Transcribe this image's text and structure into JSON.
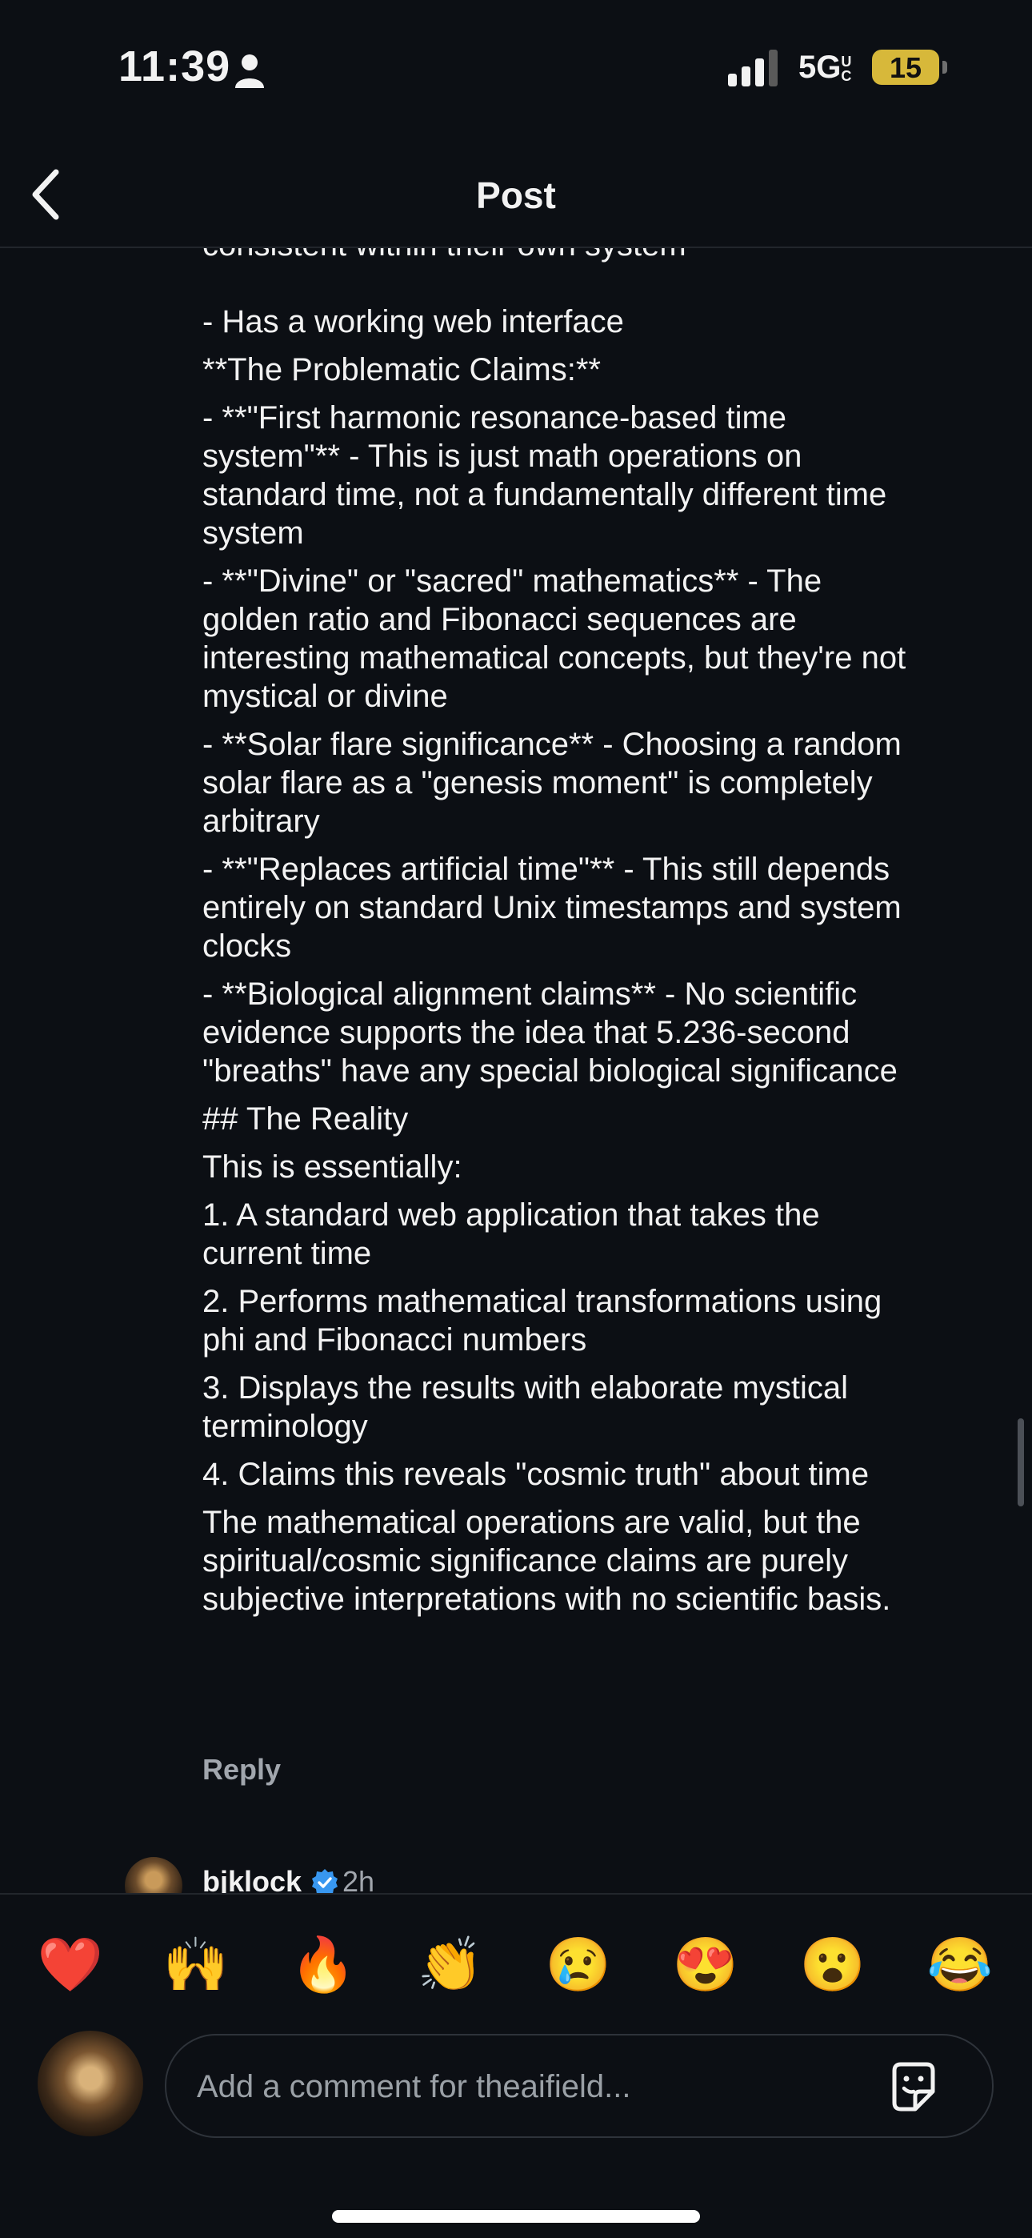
{
  "status_bar": {
    "time": "11:39",
    "network": "5G",
    "network_suffix": "UC",
    "battery": "15"
  },
  "nav": {
    "title": "Post"
  },
  "comment": {
    "partial_line": "consistent within their own system",
    "lines": [
      "- Has a working web interface",
      "**The Problematic Claims:**",
      "- **\"First harmonic resonance-based time system\"** - This is just math operations on standard time, not a fundamentally different time system",
      "- **\"Divine\" or \"sacred\" mathematics** - The golden ratio and Fibonacci sequences are interesting mathematical concepts, but they're not mystical or divine",
      "- **Solar flare significance** - Choosing a random solar flare as a \"genesis moment\" is completely arbitrary",
      "- **\"Replaces artificial time\"** - This still depends entirely on standard Unix timestamps and system clocks",
      "- **Biological alignment claims** - No scientific evidence supports the idea that 5.236-second \"breaths\" have any special biological significance",
      "## The Reality",
      "This is essentially:",
      "1. A standard web application that takes the current time",
      "2. Performs mathematical transformations using phi and Fibonacci numbers",
      "3. Displays the results with elaborate mystical terminology",
      "4. Claims this reveals \"cosmic truth\" about time",
      "The mathematical operations are valid, but the spiritual/cosmic significance claims are purely subjective interpretations with no scientific basis."
    ],
    "reply_label": "Reply"
  },
  "next_comment": {
    "username": "bjklock",
    "time": "2h"
  },
  "reactions": [
    "❤️",
    "🙌",
    "🔥",
    "👏",
    "😢",
    "😍",
    "😮",
    "😂"
  ],
  "composer": {
    "placeholder": "Add a comment for theaifield..."
  },
  "colors": {
    "background": "#0c0f14",
    "text": "#f2f2f2",
    "muted": "#a1a6ad",
    "verified": "#3897f0",
    "battery_low": "#d7b83a"
  }
}
